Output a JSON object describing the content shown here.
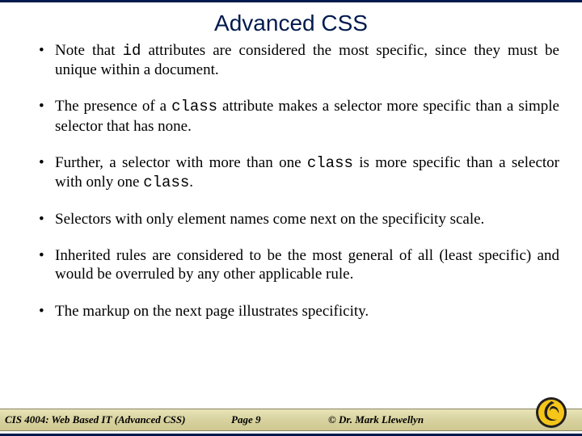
{
  "title": "Advanced CSS",
  "bullets": [
    {
      "pre": "Note that ",
      "code1": "id",
      "mid1": " attributes are considered the most specific, since they must be unique within a document.",
      "code2": "",
      "mid2": "",
      "code3": "",
      "tail": ""
    },
    {
      "pre": "The presence of a ",
      "code1": "class",
      "mid1": " attribute makes a selector more specific than a simple selector that has none.",
      "code2": "",
      "mid2": "",
      "code3": "",
      "tail": ""
    },
    {
      "pre": "Further, a selector with more than one ",
      "code1": "class",
      "mid1": " is more specific than a selector with only one ",
      "code2": "class",
      "mid2": ".",
      "code3": "",
      "tail": ""
    },
    {
      "pre": "Selectors with only element names come next on the specificity scale.",
      "code1": "",
      "mid1": "",
      "code2": "",
      "mid2": "",
      "code3": "",
      "tail": ""
    },
    {
      "pre": "Inherited rules are considered to be the most general of all (least specific) and would be overruled by any other applicable rule.",
      "code1": "",
      "mid1": "",
      "code2": "",
      "mid2": "",
      "code3": "",
      "tail": ""
    },
    {
      "pre": "The markup on the next page illustrates specificity.",
      "code1": "",
      "mid1": "",
      "code2": "",
      "mid2": "",
      "code3": "",
      "tail": ""
    }
  ],
  "footer": {
    "course": "CIS 4004: Web Based IT (Advanced CSS)",
    "page": "Page 9",
    "author": "© Dr. Mark Llewellyn"
  },
  "logo_name": "ucf-pegasus-logo"
}
